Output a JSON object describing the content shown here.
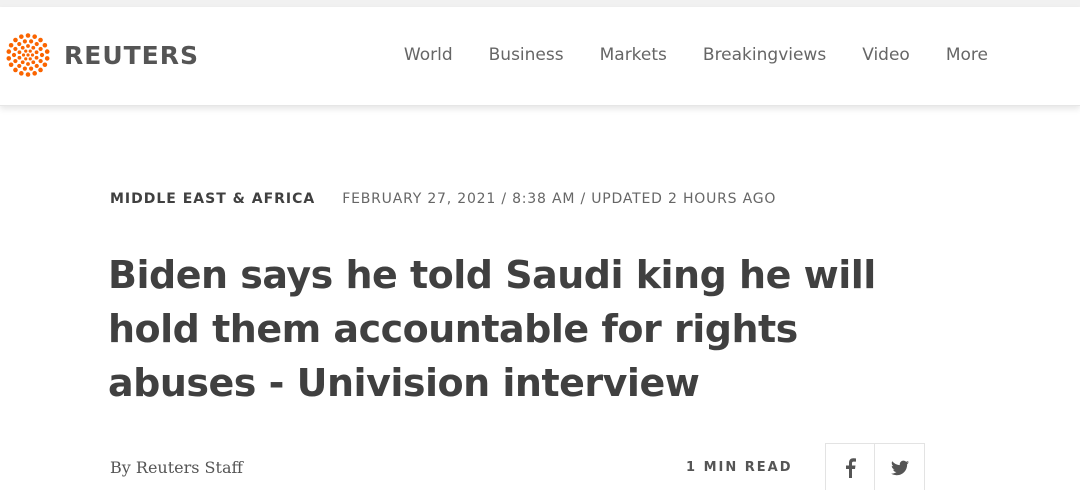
{
  "brand": {
    "name": "REUTERS",
    "accent_color": "#fa6400"
  },
  "nav": {
    "items": [
      {
        "label": "World"
      },
      {
        "label": "Business"
      },
      {
        "label": "Markets"
      },
      {
        "label": "Breakingviews"
      },
      {
        "label": "Video"
      },
      {
        "label": "More"
      }
    ]
  },
  "article": {
    "section": "MIDDLE EAST & AFRICA",
    "dateline": "FEBRUARY 27, 2021 / 8:38 AM / UPDATED 2 HOURS AGO",
    "headline": "Biden says he told Saudi king he will hold them accountable for rights abuses - Univision interview",
    "byline_prefix": "By",
    "author": "Reuters Staff",
    "read_time": "1 MIN READ"
  },
  "share": {
    "buttons": [
      {
        "icon": "facebook-icon"
      },
      {
        "icon": "twitter-icon"
      }
    ]
  }
}
